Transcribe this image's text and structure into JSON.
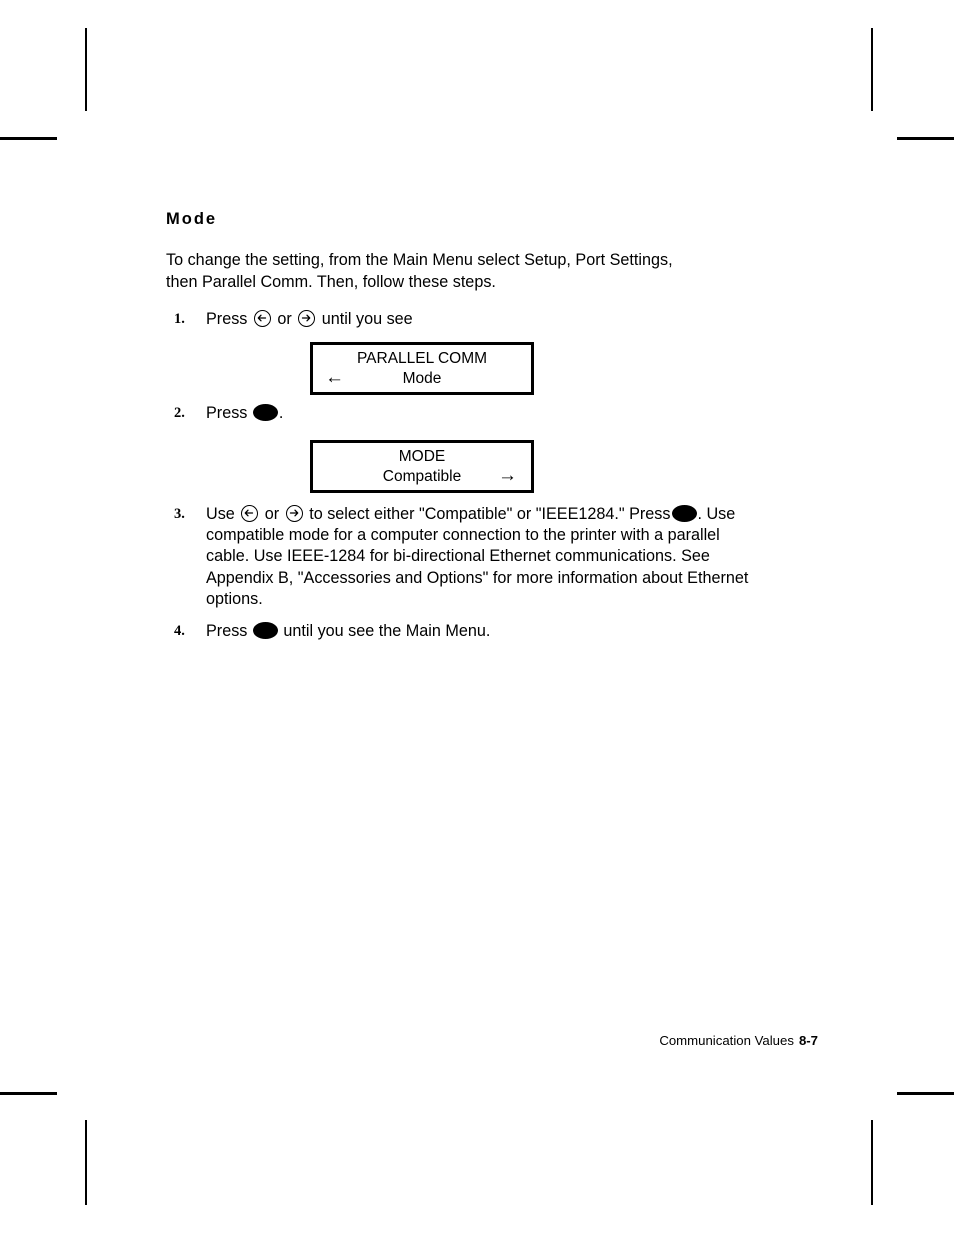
{
  "document": {
    "heading": "Mode",
    "intro": "To change the setting, from the Main Menu select Setup, Port Settings, then Parallel Comm.  Then, follow these steps."
  },
  "steps": [
    {
      "number": "1.",
      "text_before": "Press",
      "text_mid": "or",
      "text_after": "until you see"
    },
    {
      "number": "2.",
      "text_before": "Press",
      "text_after": "."
    },
    {
      "number": "3.",
      "text_before": "Use",
      "text_mid": "or",
      "text_after": "to select either \"Compatible\" or \"IEEE1284.\" Press",
      "text_tail": ".  Use compatible mode for a computer connection to the printer with a parallel cable.  Use IEEE-1284 for bi-directional Ethernet communications.  See Appendix B, \"Accessories and Options\" for more information about Ethernet options."
    },
    {
      "number": "4.",
      "text_before": "Press",
      "text_after": "until you see the Main Menu."
    }
  ],
  "lcd_displays": [
    {
      "line1": "PARALLEL COMM",
      "line2": "Mode",
      "arrow_left": "←",
      "arrow_right": ""
    },
    {
      "line1": "MODE",
      "line2": "Compatible",
      "arrow_left": "",
      "arrow_right": "→"
    }
  ],
  "footer": {
    "chapter_title": "Communication Values",
    "page_number": "8-7"
  },
  "icons": {
    "left_arrow_key": "circled-left-arrow-key",
    "right_arrow_key": "circled-right-arrow-key",
    "select_key": "filled-oval-select-key"
  },
  "colors": {
    "ink": "#000000",
    "paper": "#ffffff"
  }
}
